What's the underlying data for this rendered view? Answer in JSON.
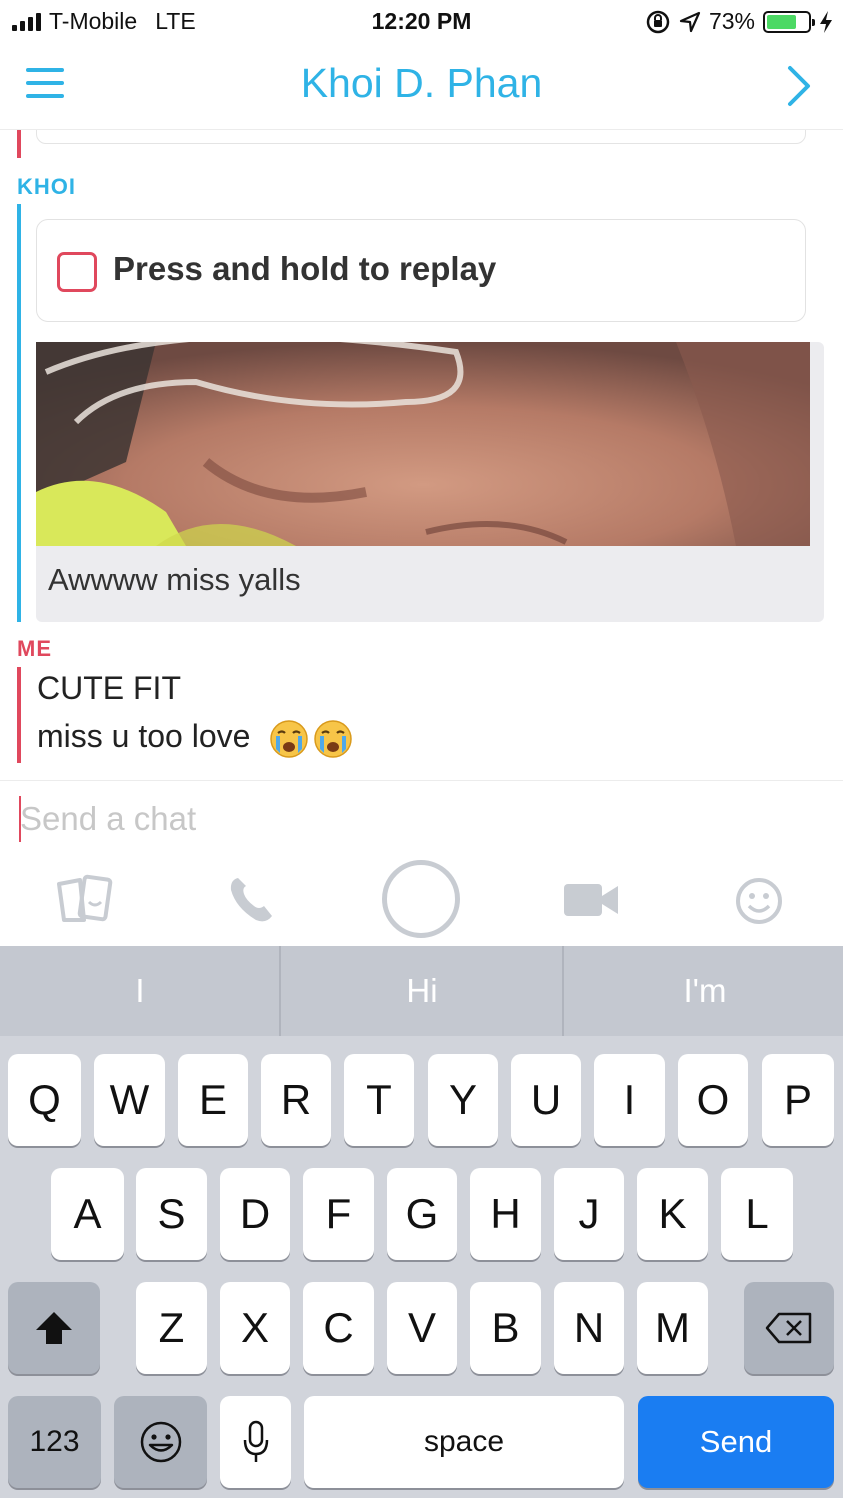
{
  "status_bar": {
    "carrier": "T-Mobile",
    "network": "LTE",
    "time": "12:20 PM",
    "battery": "73%",
    "battery_level": 0.73
  },
  "header": {
    "title": "Khoi D. Phan"
  },
  "chat": {
    "khoi_label": "KHOI",
    "replay_text": "Press and hold to replay",
    "caption": "Awwww miss yalls",
    "me_label": "ME",
    "me_messages": [
      "CUTE FIT",
      "miss u too love"
    ]
  },
  "compose": {
    "placeholder": "Send a chat"
  },
  "keyboard": {
    "predictions": [
      "I",
      "Hi",
      "I'm"
    ],
    "row1": [
      "Q",
      "W",
      "E",
      "R",
      "T",
      "Y",
      "U",
      "I",
      "O",
      "P"
    ],
    "row2": [
      "A",
      "S",
      "D",
      "F",
      "G",
      "H",
      "J",
      "K",
      "L"
    ],
    "row3": [
      "Z",
      "X",
      "C",
      "V",
      "B",
      "N",
      "M"
    ],
    "numbers_label": "123",
    "space_label": "space",
    "send_label": "Send"
  },
  "colors": {
    "accent": "#2fb3e6",
    "me": "#e0485d",
    "send_key": "#1a7df2"
  }
}
